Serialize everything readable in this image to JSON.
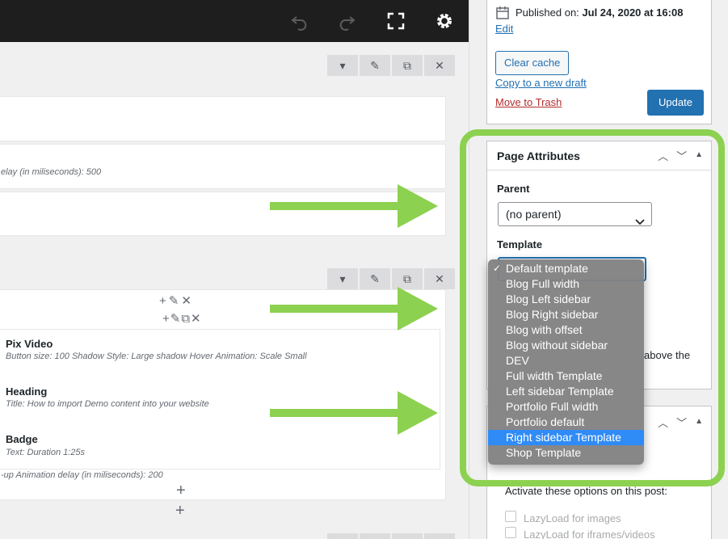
{
  "toolbar": {
    "undo_icon": "undo-icon",
    "redo_icon": "redo-icon",
    "fullscreen_icon": "fullscreen-icon",
    "settings_icon": "gear-icon"
  },
  "canvas": {
    "row1_text": "elay (in miliseconds): 500",
    "elements": [
      {
        "title": "Pix Video",
        "sub": "Button size: 100  Shadow Style: Large shadow  Hover Animation: Scale Small"
      },
      {
        "title": "Heading",
        "sub": "Title: How to import Demo content into your website"
      },
      {
        "title": "Badge",
        "sub": "Text: Duration 1:25s"
      }
    ],
    "row2_footer": "-up  Animation delay (in miliseconds): 200"
  },
  "publish": {
    "published_label": "Published on:",
    "published_date": "Jul 24, 2020 at 16:08",
    "edit_link": "Edit",
    "clear_cache": "Clear cache",
    "copy_draft": "Copy to a new draft",
    "trash": "Move to Trash",
    "update": "Update"
  },
  "page_attributes": {
    "title": "Page Attributes",
    "parent_label": "Parent",
    "parent_value": "(no parent)",
    "template_label": "Template",
    "partial_text": "above the",
    "template_options": [
      "Default template",
      "Blog Full width",
      "Blog Left sidebar",
      "Blog Right sidebar",
      "Blog with offset",
      "Blog without sidebar",
      "DEV",
      "Full width Template",
      "Left sidebar Template",
      "Portfolio Full width",
      "Portfolio default",
      "Right sidebar Template",
      "Shop Template"
    ],
    "checked_option": "Default template",
    "highlighted_option": "Right sidebar Template"
  },
  "lazy": {
    "intro": "Activate these options on this post:",
    "images": "LazyLoad for images",
    "iframes": "LazyLoad for iframes/videos"
  },
  "colors": {
    "annotation_green": "#8cd150",
    "primary_blue": "#2271b1",
    "highlight_blue": "#2f8bf6"
  }
}
